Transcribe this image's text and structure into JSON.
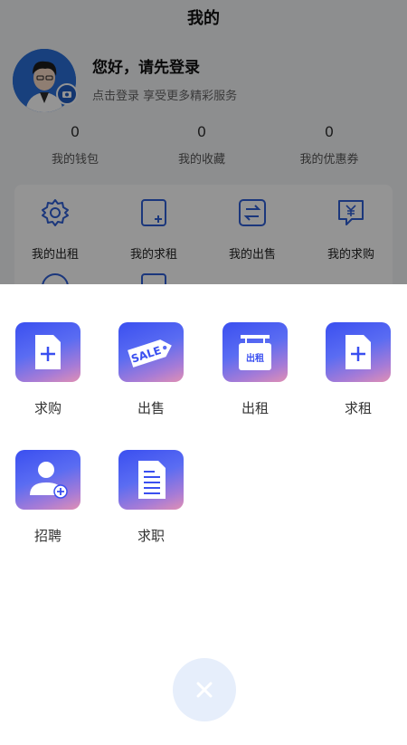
{
  "header": {
    "title": "我的"
  },
  "profile": {
    "greeting": "您好，请先登录",
    "subtitle": "点击登录 享受更多精彩服务"
  },
  "stats": [
    {
      "value": "0",
      "label": "我的钱包"
    },
    {
      "value": "0",
      "label": "我的收藏"
    },
    {
      "value": "0",
      "label": "我的优惠券"
    }
  ],
  "menu_grid": [
    {
      "label": "我的出租",
      "icon": "gear-icon"
    },
    {
      "label": "我的求租",
      "icon": "add-note-icon"
    },
    {
      "label": "我的出售",
      "icon": "exchange-icon"
    },
    {
      "label": "我的求购",
      "icon": "yen-chat-icon"
    }
  ],
  "sheet": {
    "actions": [
      {
        "label": "求购",
        "icon": "document-add-icon"
      },
      {
        "label": "出售",
        "icon": "sale-tag-icon",
        "badge_text": "SALE"
      },
      {
        "label": "出租",
        "icon": "rent-sign-icon",
        "badge_text": "出租"
      },
      {
        "label": "求租",
        "icon": "document-add-icon"
      },
      {
        "label": "招聘",
        "icon": "user-add-icon"
      },
      {
        "label": "求职",
        "icon": "resume-icon"
      }
    ],
    "close_icon": "close-icon"
  },
  "colors": {
    "accent": "#3a4ff0",
    "overlay": "rgba(0,0,0,0.42)"
  }
}
